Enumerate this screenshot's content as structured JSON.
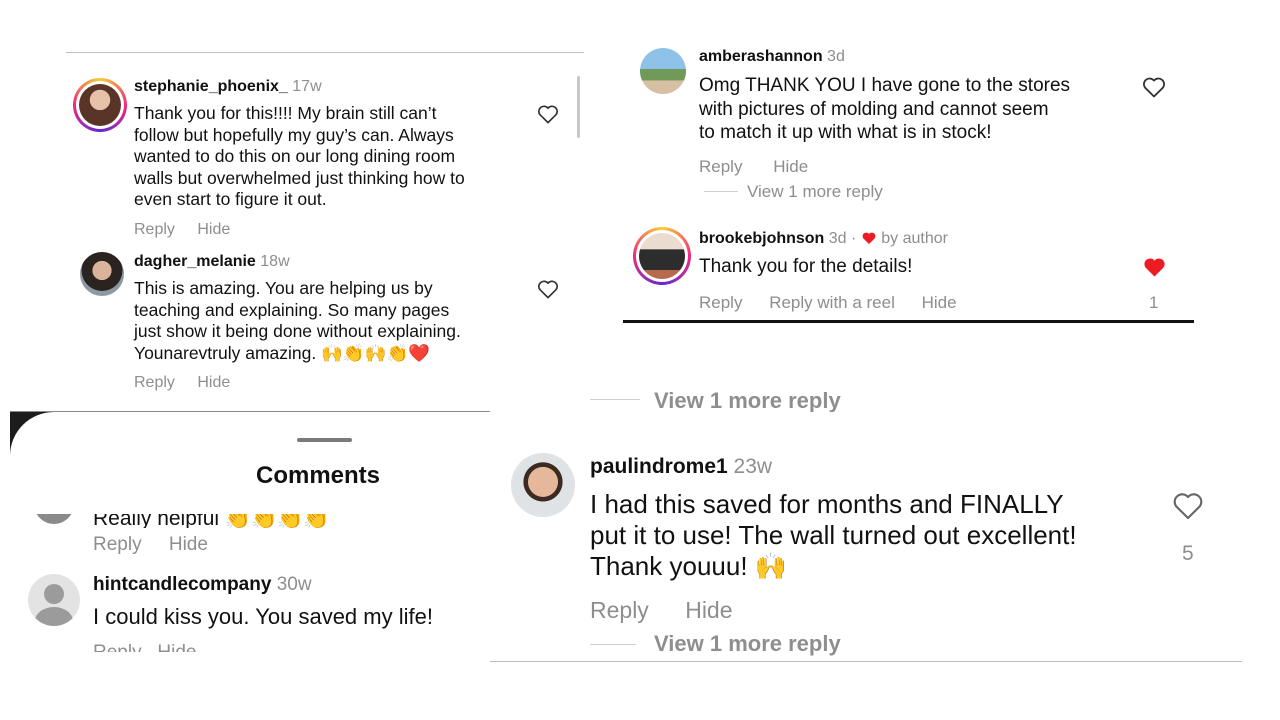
{
  "panel1": {
    "c1": {
      "username": "stephanie_phoenix_",
      "time": "17w",
      "text_lines": [
        "Thank you for this!!!! My brain still can’t",
        "follow but hopefully my guy’s can. Always",
        "wanted to do this on our long dining room",
        "walls but overwhelmed just thinking how to",
        "even start to figure it out."
      ],
      "reply": "Reply",
      "hide": "Hide"
    },
    "c2": {
      "username": "dagher_melanie",
      "time": "18w",
      "text_lines": [
        "This is amazing. You are helping us by",
        "teaching and explaining. So many pages",
        "just show it being done without explaining.",
        "Younarevtruly amazing. 🙌👏🙌👏❤️"
      ],
      "reply": "Reply",
      "hide": "Hide"
    }
  },
  "panel2": {
    "c1": {
      "username": "amberashannon",
      "time": "3d",
      "text_lines": [
        "Omg THANK YOU I have gone to the stores",
        "with pictures of molding and cannot seem",
        "to match it up with what is in stock!"
      ],
      "reply": "Reply",
      "hide": "Hide",
      "view_more": "View 1 more reply"
    },
    "c2": {
      "username": "brookebjohnson",
      "time": "3d",
      "separator": "·",
      "by_author": "by author",
      "text": "Thank you for the details!",
      "reply": "Reply",
      "reply_reel": "Reply with a reel",
      "hide": "Hide",
      "likes": "1"
    }
  },
  "panel3": {
    "title": "Comments",
    "partial_text": "Really helpful 👏👏👏👏",
    "reply": "Reply",
    "hide": "Hide",
    "c1": {
      "username": "hintcandlecompany",
      "time": "30w",
      "text": "I could kiss you. You saved my life!",
      "partial_actions": "Reply   Hide"
    }
  },
  "panel4": {
    "top_view_more": "View 1 more reply",
    "c1": {
      "username": "paulindrome1",
      "time": "23w",
      "text_lines": [
        "I had this saved for months and FINALLY",
        "put it to use! The wall turned out excellent!",
        "Thank youuu! 🙌"
      ],
      "reply": "Reply",
      "hide": "Hide",
      "likes": "5",
      "view_more": "View 1 more reply"
    }
  },
  "colors": {
    "muted": "#8e8e8e",
    "like_red": "#ed1c24",
    "divider": "#bdbdbd"
  }
}
